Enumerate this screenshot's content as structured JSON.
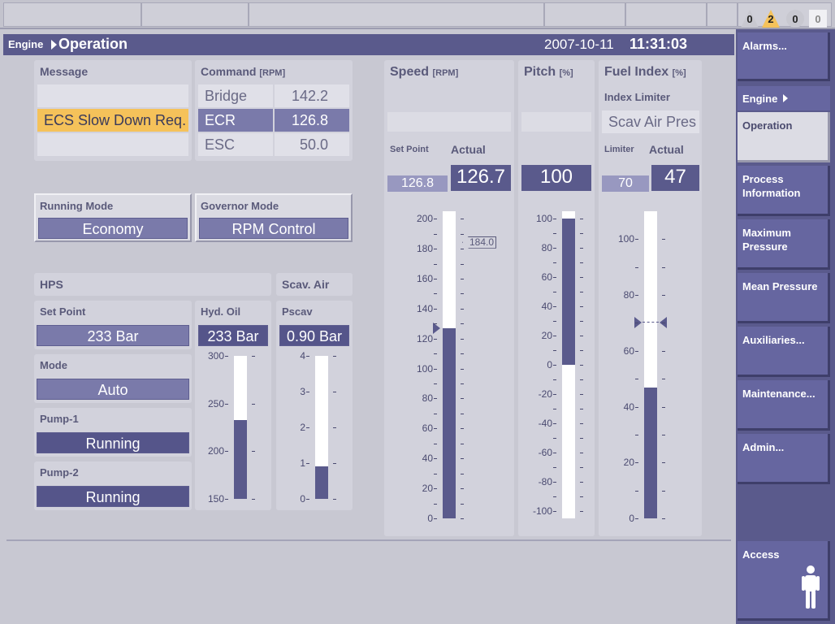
{
  "alarms": {
    "counts": [
      "0",
      "2",
      "0",
      "0"
    ],
    "colors": [
      "#c8c8d0",
      "#f5c25a",
      "#c8c8d0",
      "#f0f0f4"
    ]
  },
  "titlebar": {
    "crumb": "Engine",
    "page": "Operation",
    "date": "2007-10-11",
    "time": "11:31:03"
  },
  "message": {
    "label": "Message",
    "rows": [
      "",
      "ECS Slow Down Req.",
      ""
    ]
  },
  "command": {
    "label": "Command",
    "unit": "[RPM]",
    "rows": [
      {
        "name": "Bridge",
        "value": "142.2"
      },
      {
        "name": "ECR",
        "value": "126.8",
        "selected": true
      },
      {
        "name": "ESC",
        "value": "50.0"
      }
    ]
  },
  "running_mode": {
    "label": "Running Mode",
    "value": "Economy"
  },
  "governor_mode": {
    "label": "Governor Mode",
    "value": "RPM Control"
  },
  "hps": {
    "label": "HPS",
    "set_point_label": "Set Point",
    "set_point": "233 Bar",
    "mode_label": "Mode",
    "mode": "Auto",
    "pump1_label": "Pump-1",
    "pump1": "Running",
    "pump2_label": "Pump-2",
    "pump2": "Running",
    "hyd_oil_label": "Hyd. Oil",
    "hyd_oil": "233 Bar",
    "hyd_oil_level": 233,
    "hyd_oil_scale": [
      "300",
      "250",
      "200",
      "150"
    ]
  },
  "scav": {
    "label": "Scav. Air",
    "pscav_label": "Pscav",
    "pscav": "0.90 Bar",
    "pscav_level": 0.9,
    "scale": [
      "4",
      "3",
      "2",
      "1",
      "0"
    ]
  },
  "speed": {
    "label": "Speed",
    "unit": "[RPM]",
    "setpoint_label": "Set Point",
    "actual_label": "Actual",
    "setpoint": "126.8",
    "actual": "126.7",
    "limit_marker": "184.0",
    "level": 126.7,
    "scale": [
      "200",
      "180",
      "160",
      "140",
      "120",
      "100",
      "80",
      "60",
      "40",
      "20",
      "0"
    ]
  },
  "pitch": {
    "label": "Pitch",
    "unit": "[%]",
    "actual": "100",
    "level": 100,
    "scale": [
      "100",
      "80",
      "60",
      "40",
      "20",
      "0",
      "-20",
      "-40",
      "-60",
      "-80",
      "-100"
    ]
  },
  "fuel": {
    "label": "Fuel Index",
    "unit": "[%]",
    "limiter_title": "Index Limiter",
    "limiter_source": "Scav Air Pres",
    "limiter_label": "Limiter",
    "actual_label": "Actual",
    "limiter": "70",
    "actual": "47",
    "level": 47,
    "scale": [
      "100",
      "80",
      "60",
      "40",
      "20",
      "0"
    ]
  },
  "nav": {
    "alarms": "Alarms...",
    "engine": "Engine",
    "operation": "Operation",
    "process_info": "Process Information",
    "max_pressure": "Maximum Pressure",
    "mean_pressure": "Mean Pressure",
    "auxiliaries": "Auxiliaries...",
    "maintenance": "Maintenance...",
    "admin": "Admin...",
    "access": "Access"
  }
}
